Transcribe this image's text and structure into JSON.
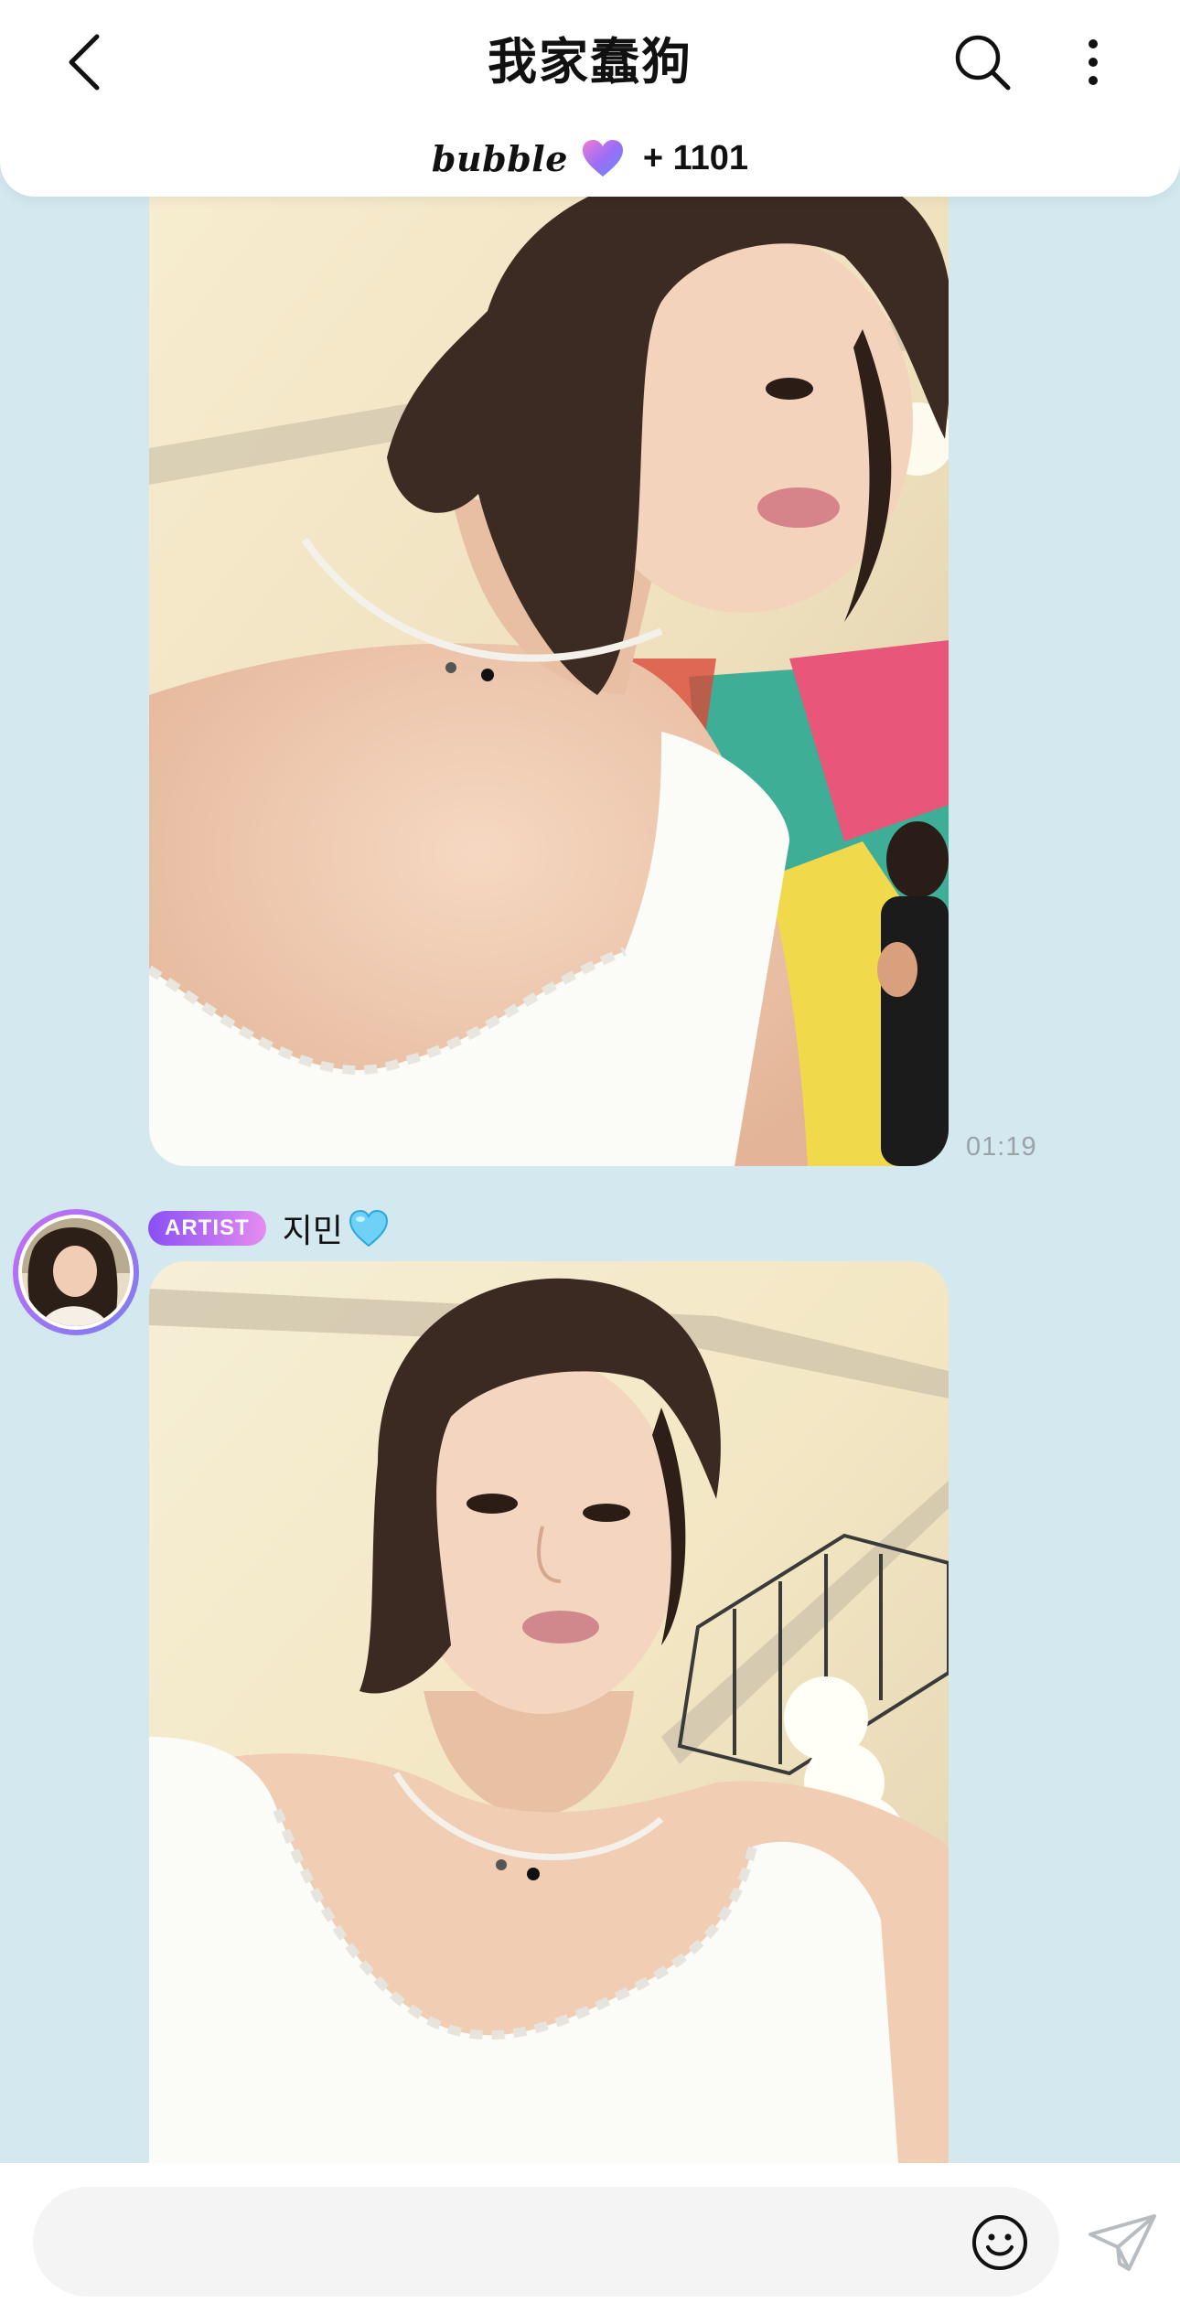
{
  "header": {
    "title": "我家蠢狗",
    "back_icon": "chevron-left-icon",
    "search_icon": "search-icon",
    "more_icon": "more-vertical-icon",
    "subscription": {
      "logo_text": "bubble",
      "heart_icon": "gradient-heart-icon",
      "count": "+ 1101"
    }
  },
  "chat": {
    "messages": [
      {
        "type": "photo",
        "timestamp": "01:19"
      },
      {
        "type": "photo",
        "sender": {
          "badge": "ARTIST",
          "name": "지민",
          "name_icon": "light-blue-heart-icon"
        }
      }
    ]
  },
  "input_bar": {
    "placeholder": "",
    "emoji_icon": "smiley-icon",
    "send_icon": "paper-plane-icon"
  },
  "colors": {
    "background": "#d3e9ef",
    "badge_start": "#8a4ff4",
    "badge_end": "#e58cf0",
    "timestamp": "#9aa2a8"
  }
}
